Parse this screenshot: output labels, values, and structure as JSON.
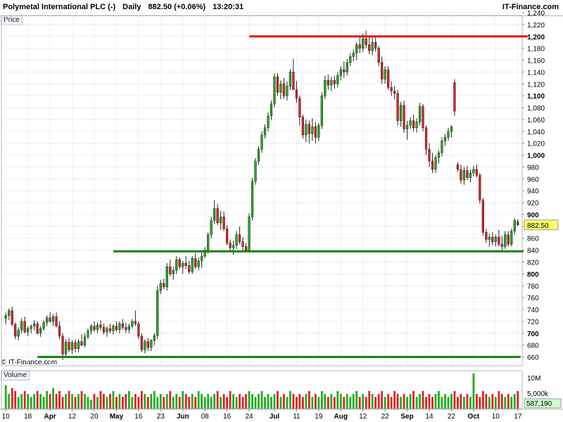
{
  "header": {
    "instrument": "Polymetal International PLC (-)",
    "interval": "Daily",
    "quote": "882.50 (+0.06%)",
    "time": "13:20:31",
    "brand": "IT-Finance.com"
  },
  "panes": {
    "price_label": "Price",
    "volume_label": "Volume"
  },
  "copyright": "© IT-Finance.com",
  "colors": {
    "up": "#22aa22",
    "down": "#dd2222",
    "support": "#108810",
    "resistance": "#ee1111",
    "last_price_bg": "#ffff66",
    "volume_last_bg": "#ccffcc"
  },
  "chart_data": [
    {
      "type": "candlestick",
      "title": "",
      "ylim": [
        650,
        1240
      ],
      "yticks": [
        660,
        680,
        700,
        720,
        740,
        760,
        780,
        800,
        820,
        840,
        860,
        880,
        900,
        920,
        940,
        960,
        980,
        1000,
        1020,
        1040,
        1060,
        1080,
        1100,
        1120,
        1140,
        1160,
        1180,
        1200,
        1220,
        1240
      ],
      "yticks_bold": [
        700,
        800,
        900,
        1000,
        1100,
        1200
      ],
      "xticks": [
        "10",
        "18",
        "Apr",
        "12",
        "20",
        "May",
        "16",
        "23",
        "Jun",
        "08",
        "16",
        "24",
        "Jul",
        "11",
        "19",
        "Aug",
        "12",
        "22",
        "Sep",
        "14",
        "22",
        "Oct",
        "10",
        "17"
      ],
      "xticks_bold": [
        "Apr",
        "May",
        "Jun",
        "Jul",
        "Aug",
        "Sep",
        "Oct"
      ],
      "last_price": "882.50",
      "candles": [
        [
          725,
          735,
          715,
          730
        ],
        [
          730,
          742,
          722,
          738
        ],
        [
          738,
          745,
          712,
          715
        ],
        [
          715,
          718,
          690,
          695
        ],
        [
          695,
          710,
          688,
          705
        ],
        [
          705,
          725,
          700,
          720
        ],
        [
          720,
          728,
          700,
          702
        ],
        [
          702,
          712,
          695,
          708
        ],
        [
          708,
          715,
          700,
          712
        ],
        [
          712,
          722,
          705,
          716
        ],
        [
          716,
          720,
          698,
          700
        ],
        [
          700,
          712,
          694,
          708
        ],
        [
          708,
          722,
          704,
          718
        ],
        [
          718,
          730,
          712,
          726
        ],
        [
          726,
          735,
          718,
          720
        ],
        [
          720,
          732,
          712,
          728
        ],
        [
          728,
          735,
          710,
          712
        ],
        [
          712,
          720,
          690,
          695
        ],
        [
          695,
          700,
          655,
          665
        ],
        [
          665,
          690,
          660,
          685
        ],
        [
          685,
          692,
          668,
          672
        ],
        [
          672,
          688,
          665,
          684
        ],
        [
          684,
          690,
          668,
          674
        ],
        [
          674,
          690,
          668,
          686
        ],
        [
          686,
          698,
          678,
          680
        ],
        [
          680,
          700,
          676,
          694
        ],
        [
          694,
          708,
          690,
          704
        ],
        [
          704,
          715,
          698,
          712
        ],
        [
          712,
          720,
          702,
          706
        ],
        [
          706,
          718,
          700,
          714
        ],
        [
          714,
          722,
          705,
          710
        ],
        [
          710,
          716,
          698,
          702
        ],
        [
          702,
          712,
          694,
          708
        ],
        [
          708,
          716,
          700,
          704
        ],
        [
          704,
          715,
          698,
          712
        ],
        [
          712,
          720,
          702,
          706
        ],
        [
          706,
          720,
          700,
          716
        ],
        [
          716,
          724,
          706,
          710
        ],
        [
          710,
          718,
          700,
          706
        ],
        [
          706,
          716,
          700,
          712
        ],
        [
          712,
          724,
          708,
          720
        ],
        [
          720,
          738,
          712,
          716
        ],
        [
          716,
          720,
          690,
          695
        ],
        [
          695,
          700,
          668,
          672
        ],
        [
          672,
          690,
          666,
          686
        ],
        [
          686,
          692,
          670,
          676
        ],
        [
          676,
          690,
          670,
          688
        ],
        [
          688,
          700,
          680,
          696
        ],
        [
          696,
          780,
          690,
          772
        ],
        [
          772,
          790,
          766,
          784
        ],
        [
          784,
          792,
          774,
          778
        ],
        [
          778,
          818,
          772,
          812
        ],
        [
          812,
          824,
          796,
          800
        ],
        [
          800,
          812,
          790,
          806
        ],
        [
          806,
          830,
          800,
          824
        ],
        [
          824,
          828,
          808,
          812
        ],
        [
          812,
          822,
          800,
          818
        ],
        [
          818,
          830,
          808,
          814
        ],
        [
          814,
          822,
          800,
          804
        ],
        [
          804,
          830,
          800,
          826
        ],
        [
          826,
          835,
          808,
          812
        ],
        [
          812,
          828,
          806,
          822
        ],
        [
          822,
          836,
          810,
          830
        ],
        [
          830,
          845,
          826,
          840
        ],
        [
          840,
          870,
          834,
          866
        ],
        [
          866,
          896,
          860,
          890
        ],
        [
          890,
          924,
          884,
          910
        ],
        [
          910,
          918,
          882,
          886
        ],
        [
          886,
          906,
          874,
          896
        ],
        [
          896,
          905,
          872,
          876
        ],
        [
          876,
          882,
          848,
          852
        ],
        [
          852,
          858,
          836,
          844
        ],
        [
          844,
          856,
          832,
          848
        ],
        [
          848,
          872,
          842,
          866
        ],
        [
          866,
          880,
          850,
          854
        ],
        [
          854,
          862,
          840,
          846
        ],
        [
          846,
          852,
          836,
          840
        ],
        [
          840,
          902,
          836,
          896
        ],
        [
          896,
          962,
          890,
          956
        ],
        [
          956,
          995,
          950,
          990
        ],
        [
          990,
          1015,
          984,
          1010
        ],
        [
          1010,
          1040,
          1004,
          1034
        ],
        [
          1034,
          1052,
          1028,
          1046
        ],
        [
          1046,
          1072,
          1040,
          1066
        ],
        [
          1066,
          1092,
          1060,
          1086
        ],
        [
          1086,
          1138,
          1080,
          1132
        ],
        [
          1132,
          1138,
          1100,
          1106
        ],
        [
          1106,
          1126,
          1094,
          1120
        ],
        [
          1120,
          1130,
          1095,
          1100
        ],
        [
          1100,
          1124,
          1092,
          1116
        ],
        [
          1116,
          1145,
          1110,
          1140
        ],
        [
          1140,
          1162,
          1132,
          1110
        ],
        [
          1110,
          1125,
          1088,
          1096
        ],
        [
          1096,
          1100,
          1050,
          1064
        ],
        [
          1064,
          1068,
          1028,
          1034
        ],
        [
          1034,
          1060,
          1022,
          1052
        ],
        [
          1052,
          1058,
          1020,
          1036
        ],
        [
          1036,
          1062,
          1024,
          1048
        ],
        [
          1048,
          1056,
          1020,
          1030
        ],
        [
          1030,
          1054,
          1024,
          1050
        ],
        [
          1050,
          1106,
          1044,
          1100
        ],
        [
          1100,
          1134,
          1094,
          1126
        ],
        [
          1126,
          1136,
          1110,
          1118
        ],
        [
          1118,
          1132,
          1108,
          1126
        ],
        [
          1126,
          1134,
          1112,
          1120
        ],
        [
          1120,
          1140,
          1114,
          1134
        ],
        [
          1134,
          1150,
          1126,
          1144
        ],
        [
          1144,
          1158,
          1130,
          1140
        ],
        [
          1140,
          1162,
          1134,
          1156
        ],
        [
          1156,
          1172,
          1150,
          1166
        ],
        [
          1166,
          1178,
          1158,
          1172
        ],
        [
          1172,
          1190,
          1160,
          1186
        ],
        [
          1186,
          1198,
          1172,
          1180
        ],
        [
          1180,
          1205,
          1174,
          1196
        ],
        [
          1196,
          1210,
          1180,
          1186
        ],
        [
          1186,
          1200,
          1170,
          1176
        ],
        [
          1176,
          1198,
          1168,
          1190
        ],
        [
          1190,
          1198,
          1174,
          1180
        ],
        [
          1180,
          1184,
          1150,
          1156
        ],
        [
          1156,
          1166,
          1120,
          1128
        ],
        [
          1128,
          1150,
          1120,
          1144
        ],
        [
          1144,
          1150,
          1110,
          1114
        ],
        [
          1114,
          1124,
          1100,
          1108
        ],
        [
          1108,
          1116,
          1094,
          1104
        ],
        [
          1104,
          1110,
          1050,
          1058
        ],
        [
          1058,
          1090,
          1048,
          1084
        ],
        [
          1084,
          1092,
          1038,
          1044
        ],
        [
          1044,
          1058,
          1026,
          1050
        ],
        [
          1050,
          1064,
          1044,
          1058
        ],
        [
          1058,
          1068,
          1040,
          1046
        ],
        [
          1046,
          1062,
          1038,
          1056
        ],
        [
          1056,
          1088,
          1050,
          1082
        ],
        [
          1082,
          1086,
          1040,
          1046
        ],
        [
          1046,
          1050,
          1000,
          1010
        ],
        [
          1010,
          1020,
          980,
          990
        ],
        [
          990,
          1004,
          970,
          976
        ],
        [
          976,
          1000,
          970,
          996
        ],
        [
          996,
          1008,
          986,
          1004
        ],
        [
          1004,
          1030,
          998,
          1024
        ],
        [
          1024,
          1036,
          1016,
          1030
        ],
        [
          1030,
          1046,
          1024,
          1040
        ],
        [
          1040,
          1050,
          1030,
          1048
        ],
        [
          1122,
          1128,
          1066,
          1074
        ],
        [
          984,
          988,
          972,
          976
        ],
        [
          976,
          984,
          952,
          958
        ],
        [
          958,
          980,
          950,
          974
        ],
        [
          974,
          982,
          958,
          962
        ],
        [
          962,
          976,
          954,
          970
        ],
        [
          970,
          982,
          964,
          976
        ],
        [
          976,
          984,
          962,
          966
        ],
        [
          966,
          970,
          918,
          924
        ],
        [
          924,
          928,
          864,
          870
        ],
        [
          870,
          876,
          852,
          858
        ],
        [
          858,
          868,
          846,
          862
        ],
        [
          862,
          870,
          848,
          854
        ],
        [
          854,
          866,
          846,
          862
        ],
        [
          862,
          874,
          846,
          850
        ],
        [
          850,
          864,
          840,
          846
        ],
        [
          846,
          872,
          842,
          866
        ],
        [
          866,
          872,
          846,
          850
        ],
        [
          850,
          876,
          846,
          872
        ],
        [
          872,
          894,
          866,
          890
        ],
        [
          888,
          892,
          880,
          882.5
        ]
      ],
      "volume": {
        "label": "Volume",
        "yticks": [
          "10M",
          "5,000k"
        ],
        "last": "587,190",
        "values": [
          8,
          5,
          7,
          6,
          4,
          5,
          6,
          5,
          4,
          5,
          6,
          5,
          4,
          6,
          5,
          7,
          5,
          6,
          4,
          5,
          6,
          5,
          4,
          5,
          6,
          5,
          4,
          3,
          5,
          4,
          6,
          5,
          4,
          5,
          6,
          4,
          5,
          4,
          5,
          6,
          4,
          5,
          4,
          6,
          5,
          4,
          5,
          6,
          4,
          5,
          4,
          5,
          6,
          4,
          5,
          4,
          6,
          5,
          4,
          5,
          4,
          6,
          5,
          4,
          5,
          4,
          5,
          6,
          4,
          5,
          4,
          6,
          5,
          4,
          5,
          4,
          5,
          6,
          5,
          4,
          5,
          6,
          4,
          5,
          4,
          5,
          6,
          4,
          5,
          4,
          6,
          5,
          4,
          5,
          4,
          5,
          6,
          4,
          5,
          4,
          6,
          5,
          4,
          5,
          4,
          6,
          5,
          4,
          5,
          4,
          5,
          6,
          4,
          5,
          4,
          6,
          5,
          4,
          5,
          6,
          4,
          5,
          4,
          6,
          5,
          4,
          5,
          4,
          5,
          6,
          4,
          5,
          6,
          4,
          5,
          4,
          5,
          6,
          4,
          5,
          4,
          5,
          6,
          4,
          5,
          4,
          5,
          4,
          12,
          5,
          4,
          6,
          5,
          4,
          5,
          4,
          6,
          5,
          4,
          5,
          4,
          5,
          6,
          5,
          4,
          6,
          5,
          4,
          5,
          4,
          3
        ]
      }
    }
  ]
}
